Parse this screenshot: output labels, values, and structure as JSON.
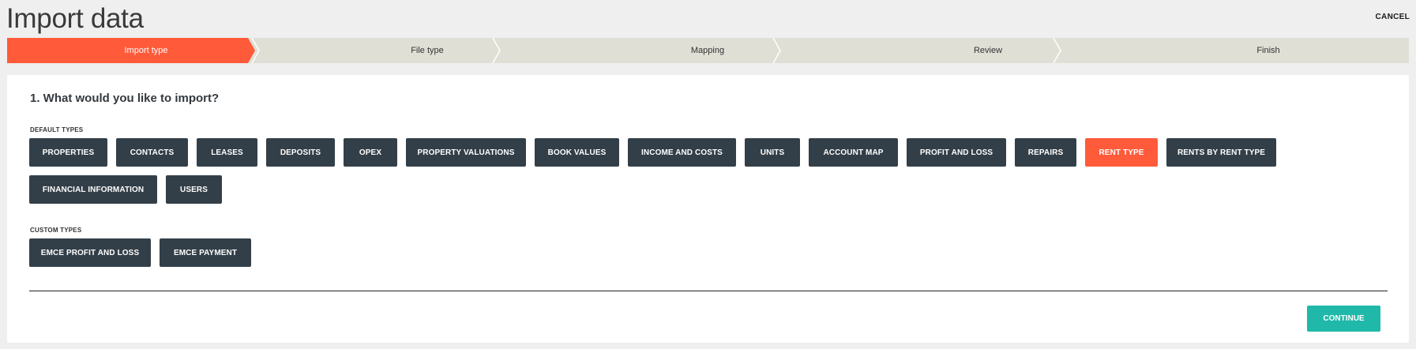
{
  "header": {
    "title": "Import data",
    "cancel_label": "CANCEL"
  },
  "wizard": {
    "active_color": "#ff5a3a",
    "inactive_color": "#dfdfd6",
    "steps": [
      {
        "label": "Import type",
        "active": true
      },
      {
        "label": "File type",
        "active": false
      },
      {
        "label": "Mapping",
        "active": false
      },
      {
        "label": "Review",
        "active": false
      },
      {
        "label": "Finish",
        "active": false
      }
    ]
  },
  "main": {
    "question": "1. What would you like to import?",
    "default_types_label": "DEFAULT TYPES",
    "default_types_row1": [
      "PROPERTIES",
      "CONTACTS",
      "LEASES",
      "DEPOSITS",
      "OPEX",
      "PROPERTY VALUATIONS",
      "BOOK VALUES",
      "INCOME AND COSTS",
      "UNITS",
      "ACCOUNT MAP",
      "PROFIT AND LOSS",
      "REPAIRS",
      "RENT TYPE",
      "RENTS BY RENT TYPE"
    ],
    "default_types_row2": [
      "FINANCIAL INFORMATION",
      "USERS"
    ],
    "custom_types_label": "CUSTOM TYPES",
    "custom_types": [
      "EMCE PROFIT AND LOSS",
      "EMCE PAYMENT"
    ],
    "selected_type": "RENT TYPE",
    "continue_label": "CONTINUE"
  },
  "colors": {
    "button_dark": "#333f48",
    "button_selected": "#ff5a3a",
    "continue": "#1fb8a9",
    "background": "#efefef"
  }
}
